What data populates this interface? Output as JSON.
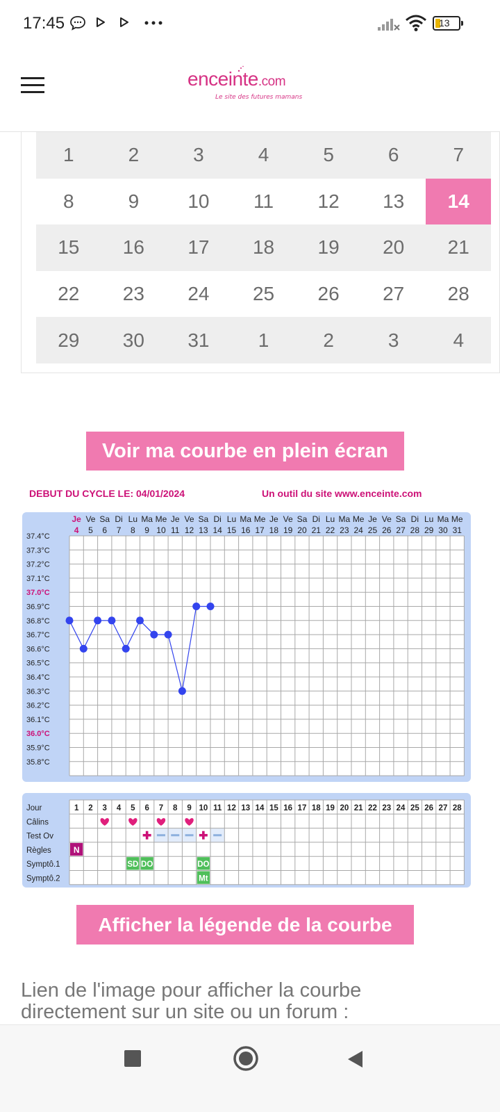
{
  "status": {
    "time": "17:45",
    "battery": "13",
    "notif_icons": [
      "chat-bubble-icon",
      "play-icon",
      "play-icon",
      "more-dots-icon"
    ],
    "system_icons": [
      "signal-icon",
      "wifi-icon",
      "battery-icon"
    ]
  },
  "header": {
    "logo_main": "enceinte",
    "logo_tld": ".com",
    "logo_tagline": "Le site des futures mamans",
    "menu_icon": "hamburger-menu-icon"
  },
  "calendar": {
    "today": "14",
    "weeks": [
      [
        "1",
        "2",
        "3",
        "4",
        "5",
        "6",
        "7"
      ],
      [
        "8",
        "9",
        "10",
        "11",
        "12",
        "13",
        "14"
      ],
      [
        "15",
        "16",
        "17",
        "18",
        "19",
        "20",
        "21"
      ],
      [
        "22",
        "23",
        "24",
        "25",
        "26",
        "27",
        "28"
      ],
      [
        "29",
        "30",
        "31",
        "1",
        "2",
        "3",
        "4"
      ]
    ]
  },
  "buttons": {
    "fullscreen": "Voir ma courbe en plein écran",
    "legend": "Afficher la légende de la courbe"
  },
  "chart": {
    "cycle_start": "DEBUT DU CYCLE LE: 04/01/2024",
    "site_credit": "Un outil du site www.enceinte.com",
    "colors": {
      "accent": "#cc1177",
      "panel": "#c0d4f6",
      "point": "#3344ee",
      "pink_button": "#f07ab0"
    }
  },
  "chart_data": {
    "type": "line",
    "title": "",
    "x": [
      {
        "wd": "Je",
        "d": "4"
      },
      {
        "wd": "Ve",
        "d": "5"
      },
      {
        "wd": "Sa",
        "d": "6"
      },
      {
        "wd": "Di",
        "d": "7"
      },
      {
        "wd": "Lu",
        "d": "8"
      },
      {
        "wd": "Ma",
        "d": "9"
      },
      {
        "wd": "Me",
        "d": "10"
      },
      {
        "wd": "Je",
        "d": "11"
      },
      {
        "wd": "Ve",
        "d": "12"
      },
      {
        "wd": "Sa",
        "d": "13"
      },
      {
        "wd": "Di",
        "d": "14"
      },
      {
        "wd": "Lu",
        "d": "15"
      },
      {
        "wd": "Ma",
        "d": "16"
      },
      {
        "wd": "Me",
        "d": "17"
      },
      {
        "wd": "Je",
        "d": "18"
      },
      {
        "wd": "Ve",
        "d": "19"
      },
      {
        "wd": "Sa",
        "d": "20"
      },
      {
        "wd": "Di",
        "d": "21"
      },
      {
        "wd": "Lu",
        "d": "22"
      },
      {
        "wd": "Ma",
        "d": "23"
      },
      {
        "wd": "Me",
        "d": "24"
      },
      {
        "wd": "Je",
        "d": "25"
      },
      {
        "wd": "Ve",
        "d": "26"
      },
      {
        "wd": "Sa",
        "d": "27"
      },
      {
        "wd": "Di",
        "d": "28"
      },
      {
        "wd": "Lu",
        "d": "29"
      },
      {
        "wd": "Ma",
        "d": "30"
      },
      {
        "wd": "Me",
        "d": "31"
      }
    ],
    "y_ticks": [
      "37.4°C",
      "37.3°C",
      "37.2°C",
      "37.1°C",
      "37.0°C",
      "36.9°C",
      "36.8°C",
      "36.7°C",
      "36.6°C",
      "36.5°C",
      "36.4°C",
      "36.3°C",
      "36.2°C",
      "36.1°C",
      "36.0°C",
      "35.9°C",
      "35.8°C"
    ],
    "highlight_ticks": [
      "37.0°C",
      "36.0°C"
    ],
    "ylim": [
      35.8,
      37.4
    ],
    "series": [
      {
        "values": [
          36.8,
          36.6,
          36.8,
          36.8,
          36.6,
          36.8,
          36.7,
          36.7,
          36.3,
          36.9,
          36.9
        ]
      }
    ],
    "grid": true
  },
  "obs_table": {
    "row_labels": [
      "Jour",
      "Câlins",
      "Test Ov",
      "Règles",
      "Symptô.1",
      "Symptô.2"
    ],
    "day_numbers": [
      "1",
      "2",
      "3",
      "4",
      "5",
      "6",
      "7",
      "8",
      "9",
      "10",
      "11",
      "12",
      "13",
      "14",
      "15",
      "16",
      "17",
      "18",
      "19",
      "20",
      "21",
      "22",
      "23",
      "24",
      "25",
      "26",
      "27",
      "28"
    ],
    "calins_days": [
      3,
      5,
      7,
      9
    ],
    "test_ov": [
      {
        "day": 6,
        "mark": "+"
      },
      {
        "day": 7,
        "mark": "−"
      },
      {
        "day": 8,
        "mark": "−"
      },
      {
        "day": 9,
        "mark": "−"
      },
      {
        "day": 10,
        "mark": "+"
      },
      {
        "day": 11,
        "mark": "−"
      }
    ],
    "regles": [
      {
        "day": 1,
        "label": "N"
      }
    ],
    "sympto1": [
      {
        "day": 5,
        "label": "SD"
      },
      {
        "day": 6,
        "label": "DO"
      },
      {
        "day": 10,
        "label": "DO"
      }
    ],
    "sympto2": [
      {
        "day": 10,
        "label": "Mt"
      }
    ]
  },
  "link_text": "Lien de l'image pour afficher la courbe directement sur un site ou un forum :",
  "nav": {
    "icons": [
      "recent-apps-icon",
      "home-icon",
      "back-icon"
    ]
  }
}
